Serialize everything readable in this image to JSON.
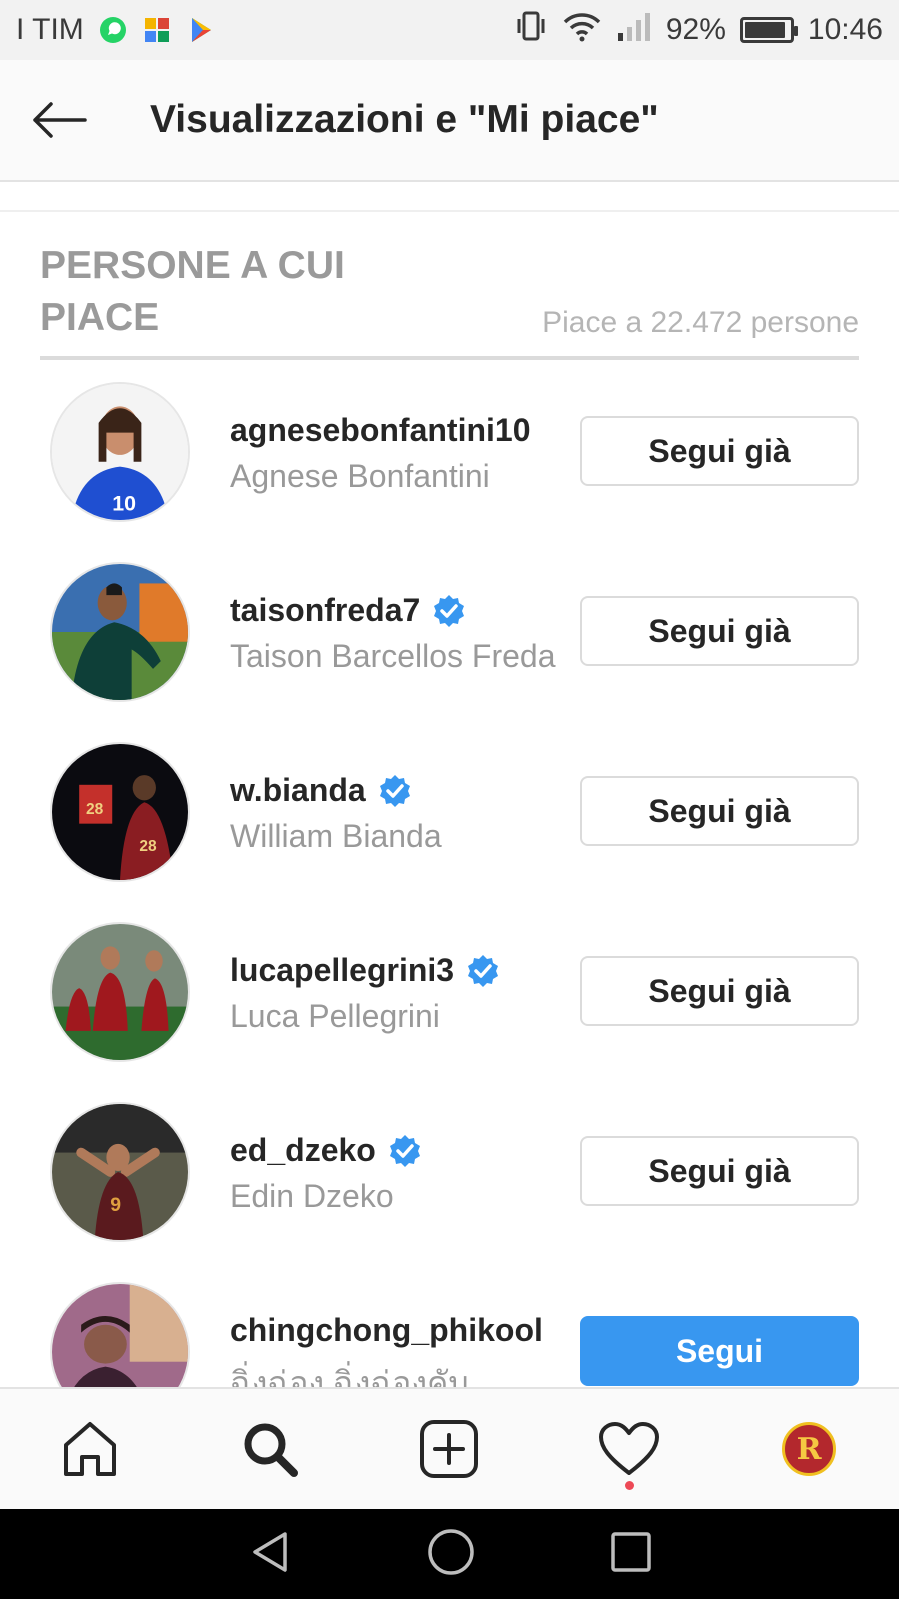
{
  "status_bar": {
    "carrier": "I TIM",
    "battery": "92%",
    "battery_level": 0.92,
    "time": "10:46",
    "icons": [
      "whatsapp-icon",
      "puzzle-app-icon",
      "play-store-icon",
      "vibrate-icon",
      "wifi-icon",
      "signal-icon",
      "battery-icon"
    ]
  },
  "header": {
    "title": "Visualizzazioni e \"Mi piace\"",
    "back_icon": "arrow-left-icon"
  },
  "section": {
    "title": "PERSONE A CUI PIACE",
    "count": "Piace a 22.472 persone"
  },
  "likers": [
    {
      "username": "agnesebonfantini10",
      "full_name": "Agnese Bonfantini",
      "verified": false,
      "button": "Segui già"
    },
    {
      "username": "taisonfreda7",
      "full_name": "Taison Barcellos Freda",
      "verified": true,
      "button": "Segui già"
    },
    {
      "username": "w.bianda",
      "full_name": "William Bianda",
      "verified": true,
      "button": "Segui già"
    },
    {
      "username": "lucapellegrini3",
      "full_name": "Luca Pellegrini",
      "verified": true,
      "button": "Segui già"
    },
    {
      "username": "ed_dzeko",
      "full_name": "Edin Dzeko",
      "verified": true,
      "button": "Segui già"
    },
    {
      "username": "chingchong_phikool",
      "full_name": "ฉิ่งฉ่อง ฉิ่งฉ่องคับ",
      "verified": false,
      "button": "Segui"
    }
  ],
  "colors": {
    "accent": "#3897f0",
    "verified": "#3897f0",
    "notification_dot": "#ed4956"
  },
  "bottom_nav": {
    "items": [
      "home-icon",
      "search-icon",
      "new-post-icon",
      "activity-heart-icon",
      "profile-avatar"
    ],
    "profile_letter": "R"
  },
  "system_nav": [
    "back-triangle-icon",
    "home-circle-icon",
    "recents-square-icon"
  ]
}
